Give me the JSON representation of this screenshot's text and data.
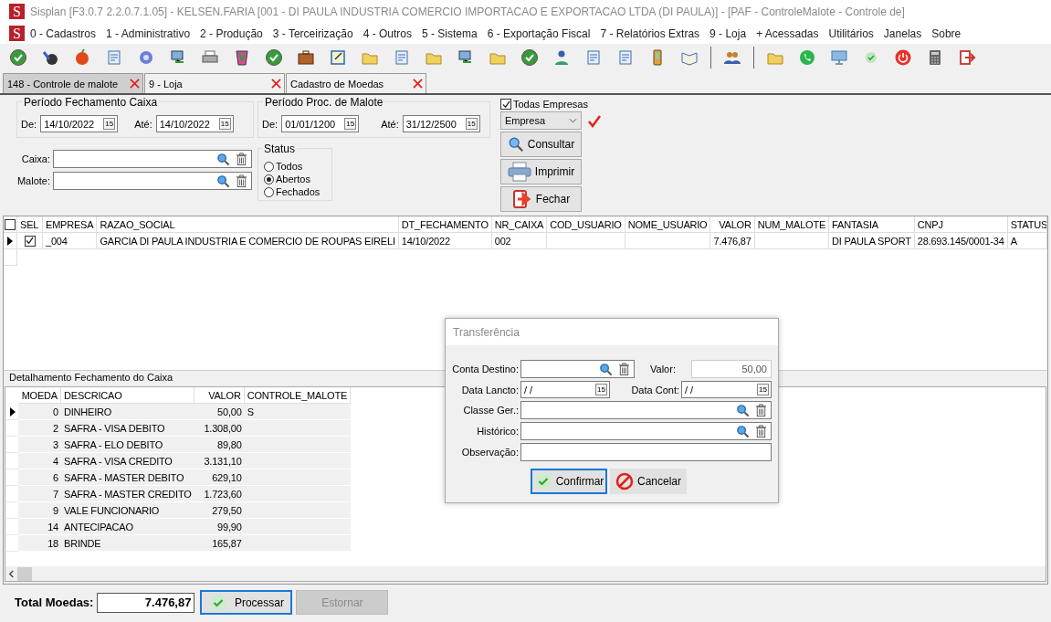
{
  "window": {
    "logo": "S",
    "title": "Sisplan [F3.0.7 2.2.0.7.1.05] - KELSEN.FARIA [001 - DI PAULA INDUSTRIA COMERCIO IMPORTACAO E EXPORTACAO LTDA (DI PAULA)] - [PAF - ControleMalote - Controle de]"
  },
  "menu": {
    "logo": "S",
    "items": [
      "0 - Cadastros",
      "1 - Administrativo",
      "2 - Produção",
      "3 - Terceirização",
      "4 - Outros",
      "5 - Sistema",
      "6 - Exportação Fiscal",
      "7 - Relatórios Extras",
      "9 - Loja",
      "+ Acessadas",
      "Utilitários",
      "Janelas",
      "Sobre"
    ]
  },
  "tabs": [
    {
      "label": "148 - Controle de malote",
      "selected": true
    },
    {
      "label": "9 - Loja",
      "selected": false
    },
    {
      "label": "Cadastro de Moedas",
      "selected": false
    }
  ],
  "filters": {
    "periods": [
      {
        "title": "Período Fechamento Caixa",
        "from_label": "De:",
        "from": {
          "value": "14/10/2022",
          "calendar": "15"
        },
        "to_label": "Até:",
        "to": {
          "value": "14/10/2022",
          "calendar": "15"
        }
      },
      {
        "title": "Período Proc. de Malote",
        "from_label": "De:",
        "from": {
          "value": "01/01/1200",
          "calendar": "15"
        },
        "to_label": "Até:",
        "to": {
          "value": "31/12/2500",
          "calendar": "15"
        }
      }
    ],
    "lookups": [
      {
        "label": "Caixa:"
      },
      {
        "label": "Malote:"
      }
    ],
    "status": {
      "title": "Status",
      "options": [
        {
          "label": "Todos",
          "selected": false
        },
        {
          "label": "Abertos",
          "selected": true
        },
        {
          "label": "Fechados",
          "selected": false
        }
      ]
    },
    "todas_empresas": {
      "label": "Todas Empresas",
      "checked": true
    },
    "empresa_select": "Empresa",
    "actions": [
      {
        "label": "Consultar",
        "kind": "search"
      },
      {
        "label": "Imprimir",
        "kind": "print"
      },
      {
        "label": "Fechar",
        "kind": "exit"
      }
    ]
  },
  "grid": {
    "header_checked": false,
    "columns": [
      {
        "label": "SEL"
      },
      {
        "label": "EMPRESA"
      },
      {
        "label": "RAZAO_SOCIAL"
      },
      {
        "label": "DT_FECHAMENTO"
      },
      {
        "label": "NR_CAIXA"
      },
      {
        "label": "COD_USUARIO"
      },
      {
        "label": "NOME_USUARIO"
      },
      {
        "label": "VALOR"
      },
      {
        "label": "NUM_MALOTE"
      },
      {
        "label": "FANTASIA"
      },
      {
        "label": "CNPJ"
      },
      {
        "label": "STATUS"
      }
    ],
    "rows": [
      {
        "current": true,
        "checked": true,
        "cells": {
          "EMPRESA": "_004",
          "RAZAO_SOCIAL": "GARCIA DI PAULA INDUSTRIA E COMERCIO DE ROUPAS EIRELI",
          "DT_FECHAMENTO": "14/10/2022",
          "NR_CAIXA": "002",
          "VALOR": "7.476,87",
          "FANTASIA": "DI PAULA SPORT",
          "CNPJ": "28.693.145/0001-34",
          "STATUS": "A"
        }
      }
    ]
  },
  "detail": {
    "title": "Detalhamento Fechamento do Caixa",
    "columns": [
      {
        "label": "MOEDA"
      },
      {
        "label": "DESCRICAO"
      },
      {
        "label": "VALOR"
      },
      {
        "label": "CONTROLE_MALOTE"
      }
    ],
    "rows": [
      {
        "current": true,
        "cells": {
          "MOEDA": "0",
          "DESCRICAO": "DINHEIRO",
          "VALOR": "50,00",
          "CONTROLE_MALOTE": "S"
        }
      },
      {
        "current": false,
        "cells": {
          "MOEDA": "2",
          "DESCRICAO": "SAFRA - VISA DEBITO",
          "VALOR": "1.308,00"
        }
      },
      {
        "current": false,
        "cells": {
          "MOEDA": "3",
          "DESCRICAO": "SAFRA - ELO DEBITO",
          "VALOR": "89,80"
        }
      },
      {
        "current": false,
        "cells": {
          "MOEDA": "4",
          "DESCRICAO": "SAFRA - VISA CREDITO",
          "VALOR": "3.131,10"
        }
      },
      {
        "current": false,
        "cells": {
          "MOEDA": "6",
          "DESCRICAO": "SAFRA - MASTER DEBITO",
          "VALOR": "629,10"
        }
      },
      {
        "current": false,
        "cells": {
          "MOEDA": "7",
          "DESCRICAO": "SAFRA - MASTER CREDITO",
          "VALOR": "1.723,60"
        }
      },
      {
        "current": false,
        "cells": {
          "MOEDA": "9",
          "DESCRICAO": "VALE FUNCIONARIO",
          "VALOR": "279,50"
        }
      },
      {
        "current": false,
        "cells": {
          "MOEDA": "14",
          "DESCRICAO": "ANTECIPACAO",
          "VALOR": "99,90"
        }
      },
      {
        "current": false,
        "cells": {
          "MOEDA": "18",
          "DESCRICAO": "BRINDE",
          "VALOR": "165,87"
        }
      }
    ]
  },
  "footer": {
    "total_label": "Total Moedas:",
    "total": "7.476,87",
    "buttons": [
      {
        "label": "Processar",
        "kind": "confirm",
        "focused": true,
        "disabled": false
      },
      {
        "label": "Estornar",
        "kind": "plain",
        "focused": false,
        "disabled": true
      }
    ]
  },
  "dialog": {
    "title": "Transferência",
    "conta_destino": {
      "label": "Conta Destino:"
    },
    "valor": {
      "label": "Valor:",
      "value": "50,00"
    },
    "data_lancto": {
      "label": "Data Lancto:",
      "value": "/ /",
      "calendar": "15"
    },
    "data_cont": {
      "label": "Data Cont:",
      "value": "/ /",
      "calendar": "15"
    },
    "classe": {
      "label": "Classe Ger.:"
    },
    "historico": {
      "label": "Histórico:"
    },
    "observacao": {
      "label": "Observação:"
    },
    "buttons": [
      {
        "label": "Confirmar",
        "kind": "confirm",
        "focused": true,
        "disabled": false
      },
      {
        "label": "Cancelar",
        "kind": "cancel",
        "focused": false,
        "disabled": false
      }
    ]
  }
}
